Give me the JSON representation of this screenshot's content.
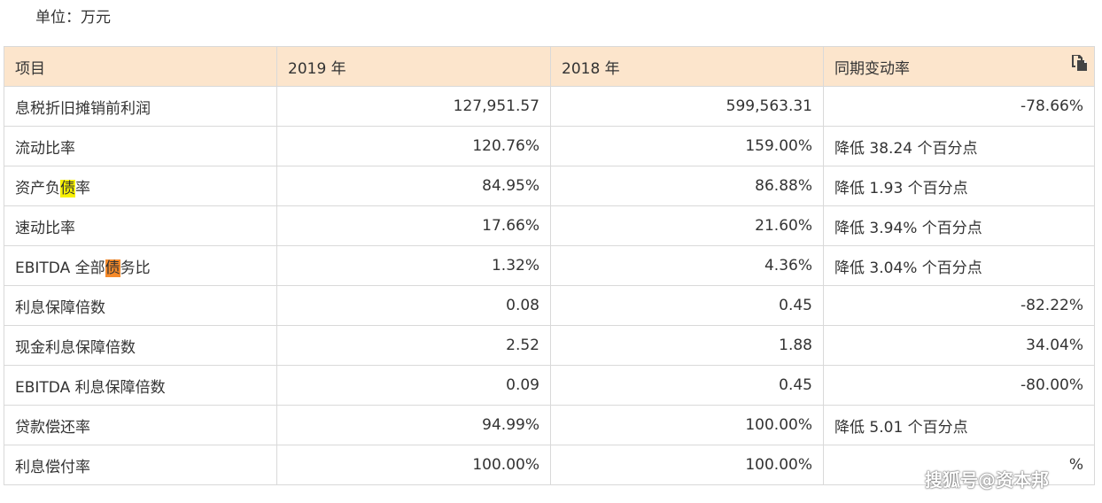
{
  "unit_label": "单位：万元",
  "table": {
    "headers": [
      "项目",
      "2019 年",
      "2018 年",
      "同期变动率"
    ],
    "rows": [
      {
        "item": "息税折旧摊销前利润",
        "y2019": "127,951.57",
        "y2018": "599,563.31",
        "change": "-78.66%"
      },
      {
        "item": "流动比率",
        "y2019": "120.76%",
        "y2018": "159.00%",
        "change": "降低 38.24 个百分点"
      },
      {
        "item_pre": "资产负",
        "item_hl": "债",
        "item_post": "率",
        "y2019": "84.95%",
        "y2018": "86.88%",
        "change": "降低 1.93 个百分点"
      },
      {
        "item": "速动比率",
        "y2019": "17.66%",
        "y2018": "21.60%",
        "change": "降低 3.94% 个百分点"
      },
      {
        "item_pre": "EBITDA 全部",
        "item_hl": "债",
        "item_post": "务比",
        "y2019": "1.32%",
        "y2018": "4.36%",
        "change": "降低 3.04% 个百分点"
      },
      {
        "item": "利息保障倍数",
        "y2019": "0.08",
        "y2018": "0.45",
        "change": "-82.22%"
      },
      {
        "item": "现金利息保障倍数",
        "y2019": "2.52",
        "y2018": "1.88",
        "change": "34.04%"
      },
      {
        "item": "EBITDA 利息保障倍数",
        "y2019": "0.09",
        "y2018": "0.45",
        "change": "-80.00%"
      },
      {
        "item": "贷款偿还率",
        "y2019": "94.99%",
        "y2018": "100.00%",
        "change": "降低 5.01 个百分点"
      },
      {
        "item": "利息偿付率",
        "y2019": "100.00%",
        "y2018": "100.00%",
        "change": "%"
      }
    ]
  },
  "icons": {
    "copy": "copy-icon"
  },
  "colors": {
    "header_bg": "#fce5cc",
    "highlight_yellow": "#f7f000",
    "highlight_orange": "#f58a2a",
    "border": "#d9d9d9"
  },
  "watermark": "搜狐号@资本邦"
}
